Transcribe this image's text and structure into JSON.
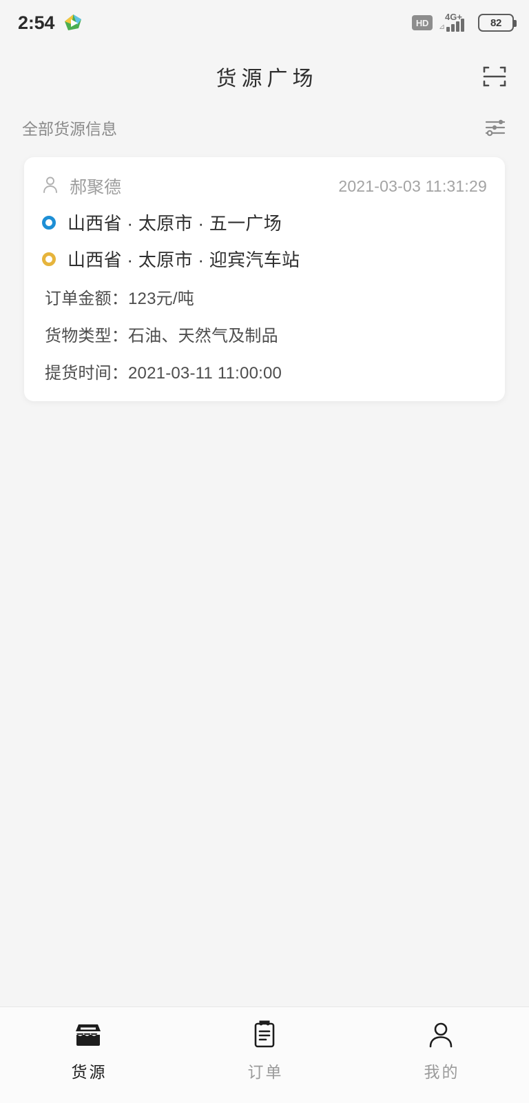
{
  "status_bar": {
    "time": "2:54",
    "app_icon": "media-play-icon",
    "hd_badge": "HD",
    "network_type": "4G+",
    "battery_level": "82"
  },
  "header": {
    "title": "货源广场",
    "scan_icon": "scan-code-icon"
  },
  "filter_bar": {
    "label": "全部货源信息",
    "filter_icon": "sliders-filter-icon"
  },
  "cards": [
    {
      "poster_icon": "person-icon",
      "poster_name": "郝聚德",
      "posted_at": "2021-03-03 11:31:29",
      "origin": "山西省 · 太原市 · 五一广场",
      "destination": "山西省 · 太原市 · 迎宾汽车站",
      "origin_dot_color": "#1e8fd5",
      "destination_dot_color": "#e6b43c",
      "details": [
        {
          "key": "订单金额：",
          "value": "123元/吨"
        },
        {
          "key": "货物类型：",
          "value": "石油、天然气及制品"
        },
        {
          "key": "提货时间：",
          "value": "2021-03-11 11:00:00"
        }
      ]
    }
  ],
  "tab_bar": {
    "items": [
      {
        "label": "货源",
        "icon": "store-icon",
        "active": true
      },
      {
        "label": "订单",
        "icon": "clipboard-icon",
        "active": false
      },
      {
        "label": "我的",
        "icon": "person-outline-icon",
        "active": false
      }
    ]
  }
}
